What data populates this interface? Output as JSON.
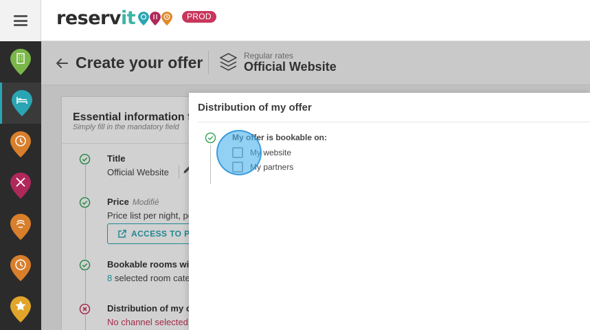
{
  "app": {
    "logo_main": "reserv",
    "logo_accent": "it",
    "env_badge": "PROD",
    "pin_colors": [
      "#2aa5b3",
      "#b0285a",
      "#e08a2e"
    ]
  },
  "topbar": {
    "menu_icon": "hamburger-icon"
  },
  "sidebar": {
    "items": [
      {
        "icon": "hotel-pin-icon",
        "color": "#7ab648",
        "active": false
      },
      {
        "icon": "bed-pin-icon",
        "color": "#2aa5b3",
        "active": true
      },
      {
        "icon": "clock-pin-icon",
        "color": "#d97f2b",
        "active": false
      },
      {
        "icon": "restaurant-pin-icon",
        "color": "#b0285a",
        "active": false
      },
      {
        "icon": "spa-pin-icon",
        "color": "#d97f2b",
        "active": false
      },
      {
        "icon": "clock-pin-icon",
        "color": "#d97f2b",
        "active": false
      },
      {
        "icon": "star-pin-icon",
        "color": "#e0a52a",
        "active": false
      }
    ]
  },
  "header": {
    "title": "Create your offer",
    "rate_sub": "Regular rates",
    "rate_main": "Official Website"
  },
  "card": {
    "title": "Essential information fo",
    "subtitle": "Simply fill in the mandatory field",
    "steps": [
      {
        "title": "Title",
        "value": "Official Website",
        "status": "ok"
      },
      {
        "title": "Price",
        "tag": "Modifié",
        "value": "Price list per night, pe",
        "button": "ACCESS TO PR",
        "status": "ok"
      },
      {
        "title": "Bookable rooms with",
        "value_num": "8",
        "value": " selected room cate",
        "status": "ok"
      },
      {
        "title": "Distribution of my of",
        "value": "No channel selected",
        "status": "error"
      }
    ]
  },
  "panel": {
    "title": "Distribution of my offer",
    "bookable_label": "My offer is bookable on:",
    "options": [
      {
        "label": "My website",
        "checked": false
      },
      {
        "label": "My partners",
        "checked": false
      }
    ]
  },
  "colors": {
    "accent": "#2aa5b3",
    "success": "#3aa65b",
    "error": "#c8365c"
  }
}
